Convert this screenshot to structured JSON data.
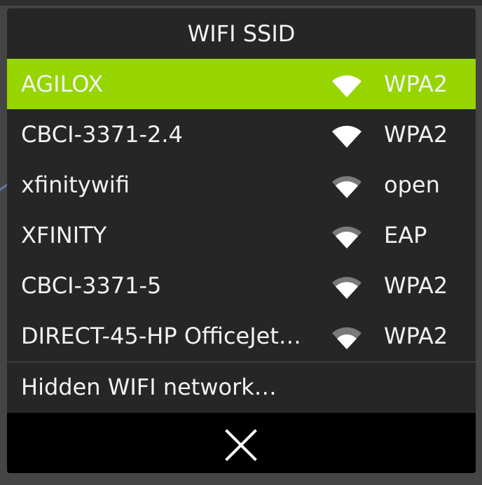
{
  "dialog": {
    "title": "WIFI SSID",
    "networks": [
      {
        "ssid": "AGILOX",
        "security": "WPA2",
        "signal": "full",
        "selected": true
      },
      {
        "ssid": "CBCI-3371-2.4",
        "security": "WPA2",
        "signal": "full",
        "selected": false
      },
      {
        "ssid": "xfinitywifi",
        "security": "open",
        "signal": "medium",
        "selected": false
      },
      {
        "ssid": "XFINITY",
        "security": "EAP",
        "signal": "medium",
        "selected": false
      },
      {
        "ssid": "CBCI-3371-5",
        "security": "WPA2",
        "signal": "medium",
        "selected": false
      },
      {
        "ssid": "DIRECT-45-HP OfficeJet…",
        "security": "WPA2",
        "signal": "low",
        "selected": false
      }
    ],
    "hidden_network_label": "Hidden WIFI network…",
    "close_icon": "close-icon"
  },
  "colors": {
    "accent": "#96d500",
    "dialog_bg": "#262626",
    "close_bar_bg": "#000000",
    "text": "#f2f2f2",
    "signal_dim": "#7a7a7a"
  }
}
